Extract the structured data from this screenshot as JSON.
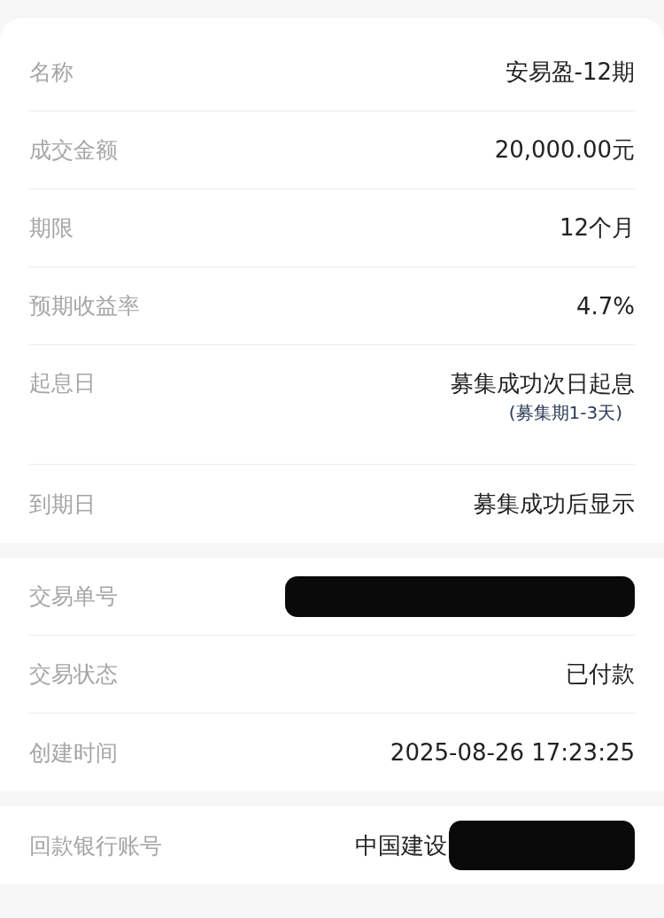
{
  "sections": [
    {
      "rows": [
        {
          "label": "名称",
          "value": "安易盈-12期",
          "redacted": false
        },
        {
          "label": "成交金额",
          "value": "20,000.00元",
          "redacted": false
        },
        {
          "label": "期限",
          "value": "12个月",
          "redacted": false
        },
        {
          "label": "预期收益率",
          "value": "4.7%",
          "redacted": false
        },
        {
          "label": "起息日",
          "value": "募集成功次日起息",
          "note": "(募集期1-3天)",
          "redacted": false
        },
        {
          "label": "到期日",
          "value": "募集成功后显示",
          "redacted": false
        }
      ]
    },
    {
      "rows": [
        {
          "label": "交易单号",
          "redacted": true
        },
        {
          "label": "交易状态",
          "value": "已付款",
          "redacted": false
        },
        {
          "label": "创建时间",
          "value": "2025-08-26 17:23:25",
          "redacted": false
        }
      ]
    },
    {
      "rows": [
        {
          "label": "回款银行账号",
          "value": "中国建设",
          "redacted": true
        }
      ]
    }
  ]
}
